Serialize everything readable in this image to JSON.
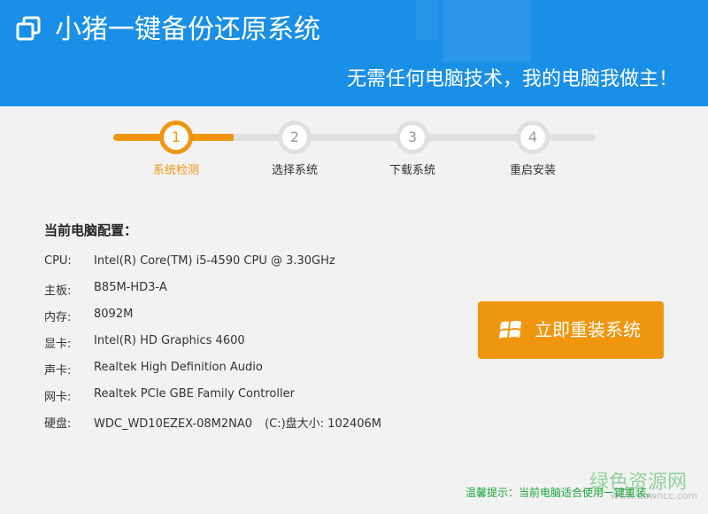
{
  "header": {
    "title": "小猪一键备份还原系统",
    "slogan": "无需任何电脑技术，我的电脑我做主！",
    "app_icon": "restore-window-icon"
  },
  "steps": [
    {
      "number": "1",
      "label": "系统检测",
      "active": true
    },
    {
      "number": "2",
      "label": "选择系统",
      "active": false
    },
    {
      "number": "3",
      "label": "下载系统",
      "active": false
    },
    {
      "number": "4",
      "label": "重启安装",
      "active": false
    }
  ],
  "config": {
    "title": "当前电脑配置：",
    "rows": [
      {
        "key": "CPU:",
        "value": "Intel(R) Core(TM) i5-4590 CPU @ 3.30GHz"
      },
      {
        "key": "主板:",
        "value": "B85M-HD3-A"
      },
      {
        "key": "内存:",
        "value": "8092M"
      },
      {
        "key": "显卡:",
        "value": "Intel(R) HD Graphics 4600"
      },
      {
        "key": "声卡:",
        "value": "Realtek High Definition Audio"
      },
      {
        "key": "网卡:",
        "value": "Realtek PCIe GBE Family Controller"
      },
      {
        "key": "硬盘:",
        "value": "WDC_WD10EZEX-08M2NA0",
        "extra": "(C:)盘大小: 102406M"
      }
    ]
  },
  "install_button": {
    "label": "立即重装系统",
    "icon": "windows-logo-icon"
  },
  "tip": "温馨提示：当前电脑适合使用一键重装。",
  "watermark": {
    "text": "绿色资源网",
    "sub": "www.downcc.com"
  },
  "colors": {
    "header_bg": "#1a8fe8",
    "accent": "#f0960e",
    "tip": "#1aa53a",
    "page_bg": "#f2f2f2"
  }
}
